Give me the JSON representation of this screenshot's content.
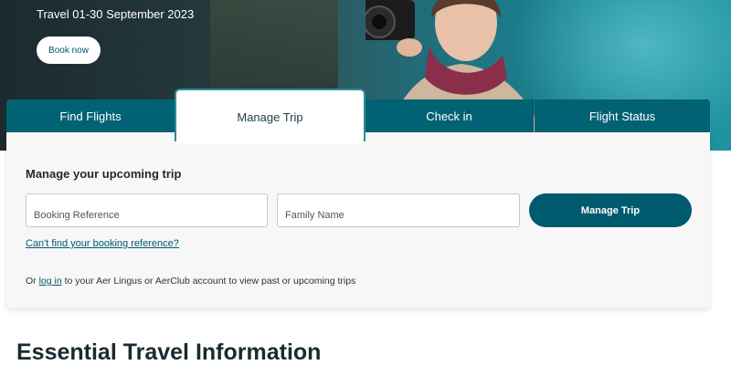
{
  "hero": {
    "travel_dates": "Travel 01-30 September 2023",
    "book_now_label": "Book now"
  },
  "tabs": [
    {
      "label": "Find Flights",
      "active": false
    },
    {
      "label": "Manage Trip",
      "active": true
    },
    {
      "label": "Check in",
      "active": false
    },
    {
      "label": "Flight Status",
      "active": false
    }
  ],
  "manage": {
    "title": "Manage your upcoming trip",
    "booking_reference_placeholder": "Booking Reference",
    "family_name_placeholder": "Family Name",
    "submit_label": "Manage Trip",
    "cant_find_link": "Can't find your booking reference?",
    "login_prefix": "Or",
    "login_link": "log in",
    "login_suffix": "to your Aer Lingus or AerClub account to view past or upcoming trips"
  },
  "section": {
    "heading": "Essential Travel Information"
  },
  "colors": {
    "brand_teal": "#006272",
    "button_teal": "#005a6e",
    "active_tab_border": "#2a8e96"
  }
}
